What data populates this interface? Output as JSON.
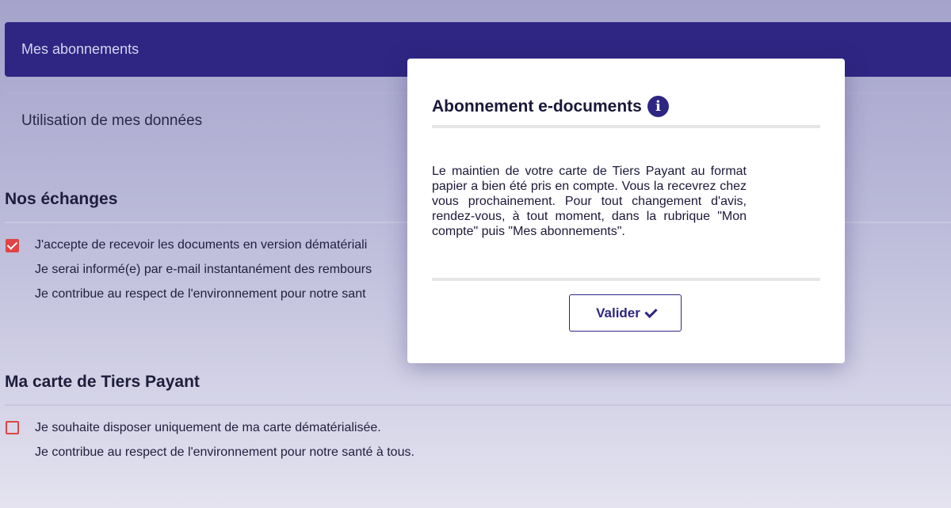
{
  "nav": {
    "active_item": "Mes abonnements",
    "item_data_usage": "Utilisation de mes données"
  },
  "section_exchanges": {
    "title": "Nos échanges",
    "checked": true,
    "lines": [
      "J'accepte de recevoir les documents en version dématériali",
      "Je serai informé(e) par e-mail instantanément des rembours",
      "Je contribue au respect de l'environnement pour notre sant"
    ]
  },
  "section_card": {
    "title": "Ma carte de Tiers Payant",
    "checked": false,
    "lines": [
      "Je souhaite disposer uniquement de ma carte dématérialisée.",
      "Je contribue au respect de l'environnement pour notre santé à tous."
    ]
  },
  "modal": {
    "title": "Abonnement e-documents",
    "info_icon_glyph": "i",
    "body": "Le maintien de votre carte de Tiers Payant au format papier a bien été pris en compte. Vous la recevrez chez vous prochainement. Pour tout changement d'avis, rendez-vous, à tout moment, dans la rubrique \"Mon compte\" puis \"Mes abonnements\".",
    "button_label": "Valider"
  },
  "colors": {
    "primary": "#2e2682",
    "checkbox": "#e04444"
  }
}
